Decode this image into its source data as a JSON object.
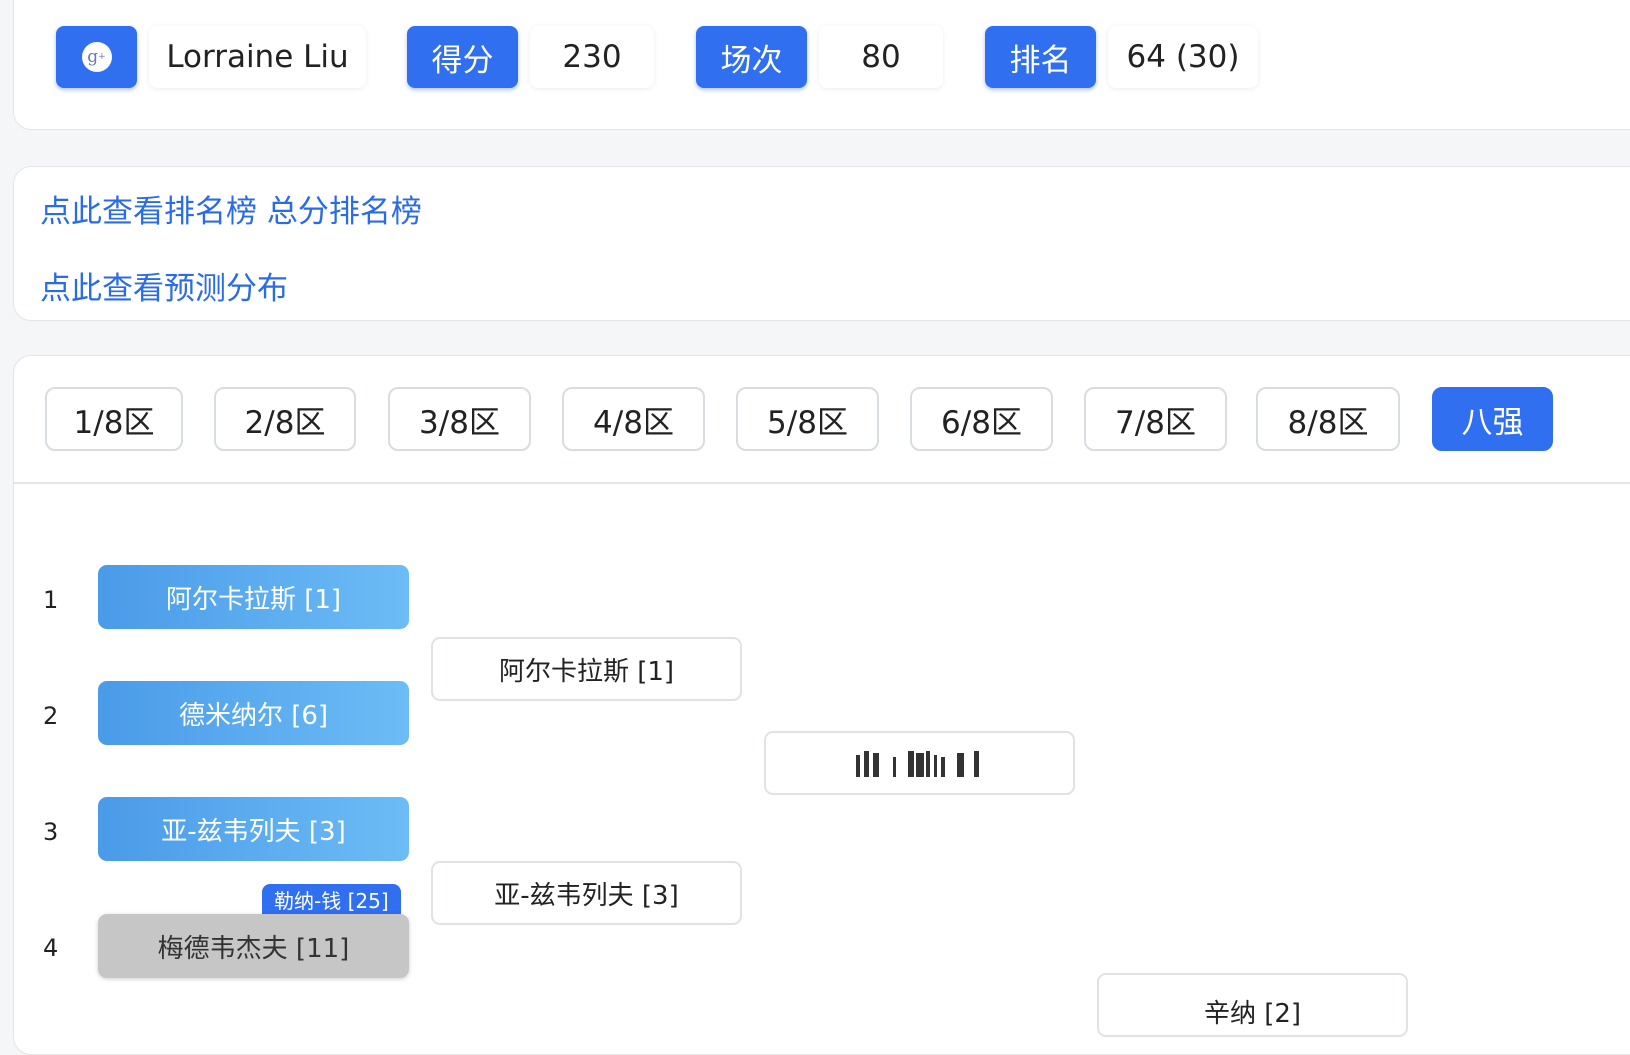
{
  "user": {
    "avatar_icon": "google-plus-icon",
    "name": "Lorraine Liu",
    "score_label": "得分",
    "score_value": "230",
    "matches_label": "场次",
    "matches_value": "80",
    "rank_label": "排名",
    "rank_value": "64 (30)"
  },
  "links": {
    "ranking_prefix": "点此查看排名榜",
    "ranking_total": "总分排名榜",
    "distribution": "点此查看预测分布"
  },
  "tabs": [
    {
      "label": "1/8区",
      "active": false
    },
    {
      "label": "2/8区",
      "active": false
    },
    {
      "label": "3/8区",
      "active": false
    },
    {
      "label": "4/8区",
      "active": false
    },
    {
      "label": "5/8区",
      "active": false
    },
    {
      "label": "6/8区",
      "active": false
    },
    {
      "label": "7/8区",
      "active": false
    },
    {
      "label": "8/8区",
      "active": false
    },
    {
      "label": "八强",
      "active": true
    }
  ],
  "bracket": {
    "seeds": [
      "1",
      "2",
      "3",
      "4"
    ],
    "round1": [
      {
        "name": "阿尔卡拉斯 [1]",
        "state": "picked"
      },
      {
        "name": "德米纳尔 [6]",
        "state": "picked"
      },
      {
        "name": "亚-兹韦列夫 [3]",
        "state": "picked"
      },
      {
        "name": "梅德韦杰夫 [11]",
        "state": "eliminated",
        "tag": "勒纳-钱 [25]"
      }
    ],
    "round2": [
      {
        "name": "阿尔卡拉斯 [1]"
      },
      {
        "name": "亚-兹韦列夫 [3]"
      }
    ],
    "round3": [
      {
        "name": "",
        "obscured": true
      },
      {
        "name": "辛纳 [2]"
      }
    ]
  },
  "colors": {
    "accent": "#2f6ff0",
    "link": "#2a6be6",
    "picked_start": "#4a9be8",
    "picked_end": "#6cbcf6",
    "eliminated": "#c6c6c6"
  }
}
